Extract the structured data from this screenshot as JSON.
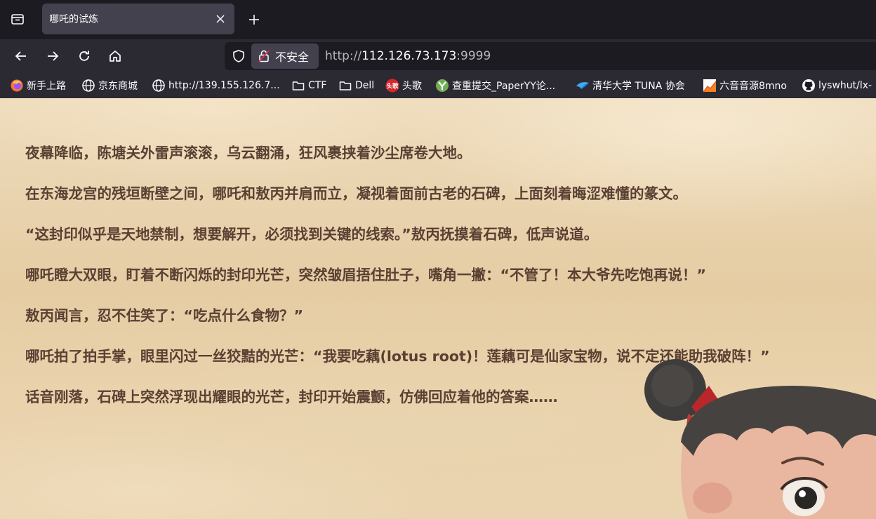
{
  "tabs": [
    {
      "title": "哪吒的试炼"
    }
  ],
  "navbar": {
    "identity_label": "不安全",
    "url_prefix": "http://",
    "url_host": "112.126.73.173",
    "url_port": ":9999"
  },
  "bookmarks": [
    {
      "label": "新手上路",
      "icon": "firefox-icon"
    },
    {
      "label": "京东商城",
      "icon": "globe-icon"
    },
    {
      "label": "http://139.155.126.7...",
      "icon": "globe-icon"
    },
    {
      "label": "CTF",
      "icon": "folder-icon"
    },
    {
      "label": "Dell",
      "icon": "folder-icon"
    },
    {
      "label": "头歌",
      "icon": "toutiao-icon",
      "badge": "头歌"
    },
    {
      "label": "查重提交_PaperYY论...",
      "icon": "paperyy-icon"
    },
    {
      "label": "清华大学 TUNA 协会",
      "icon": "tuna-icon"
    },
    {
      "label": "六音音源8mno",
      "icon": "chart-favicon-icon"
    },
    {
      "label": "lyswhut/lx-",
      "icon": "github-icon"
    }
  ],
  "content": {
    "paragraphs": [
      "夜幕降临，陈塘关外雷声滚滚，乌云翻涌，狂风裹挟着沙尘席卷大地。",
      "在东海龙宫的残垣断壁之间，哪吒和敖丙并肩而立，凝视着面前古老的石碑，上面刻着晦涩难懂的篆文。",
      "“这封印似乎是天地禁制，想要解开，必须找到关键的线索。”敖丙抚摸着石碑，低声说道。",
      "哪吒瞪大双眼，盯着不断闪烁的封印光芒，突然皱眉捂住肚子，嘴角一撇：“不管了！本大爷先吃饱再说！”",
      "敖丙闻言，忍不住笑了：“吃点什么食物？”",
      "哪吒拍了拍手掌，眼里闪过一丝狡黠的光芒：“我要吃藕(lotus root)！莲藕可是仙家宝物，说不定还能助我破阵！”",
      "话音刚落，石碑上突然浮现出耀眼的光芒，封印开始震颤，仿佛回应着他的答案……"
    ]
  }
}
